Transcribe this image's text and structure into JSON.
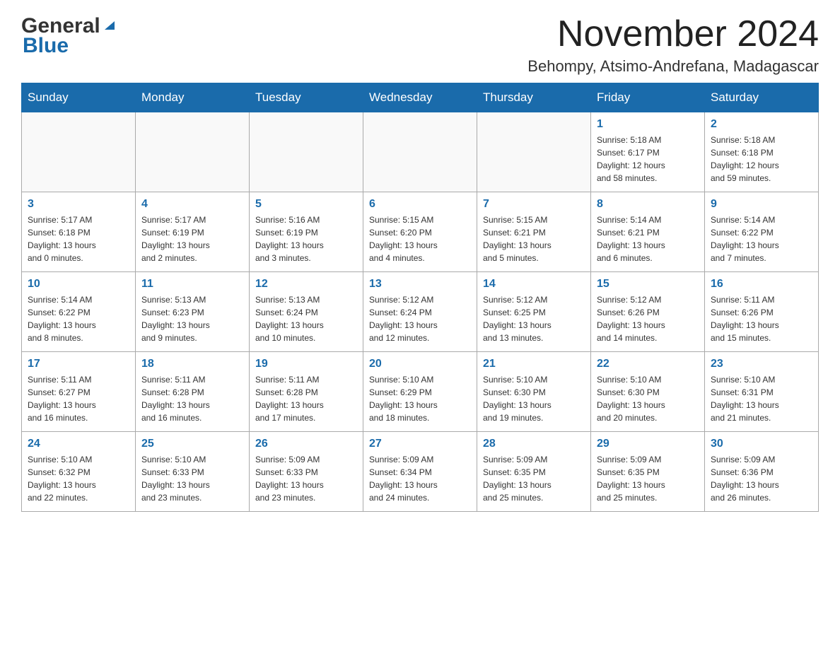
{
  "header": {
    "logo_general": "General",
    "logo_blue": "Blue",
    "month_title": "November 2024",
    "location": "Behompy, Atsimo-Andrefana, Madagascar"
  },
  "days_of_week": [
    "Sunday",
    "Monday",
    "Tuesday",
    "Wednesday",
    "Thursday",
    "Friday",
    "Saturday"
  ],
  "weeks": [
    [
      {
        "day": "",
        "info": ""
      },
      {
        "day": "",
        "info": ""
      },
      {
        "day": "",
        "info": ""
      },
      {
        "day": "",
        "info": ""
      },
      {
        "day": "",
        "info": ""
      },
      {
        "day": "1",
        "info": "Sunrise: 5:18 AM\nSunset: 6:17 PM\nDaylight: 12 hours\nand 58 minutes."
      },
      {
        "day": "2",
        "info": "Sunrise: 5:18 AM\nSunset: 6:18 PM\nDaylight: 12 hours\nand 59 minutes."
      }
    ],
    [
      {
        "day": "3",
        "info": "Sunrise: 5:17 AM\nSunset: 6:18 PM\nDaylight: 13 hours\nand 0 minutes."
      },
      {
        "day": "4",
        "info": "Sunrise: 5:17 AM\nSunset: 6:19 PM\nDaylight: 13 hours\nand 2 minutes."
      },
      {
        "day": "5",
        "info": "Sunrise: 5:16 AM\nSunset: 6:19 PM\nDaylight: 13 hours\nand 3 minutes."
      },
      {
        "day": "6",
        "info": "Sunrise: 5:15 AM\nSunset: 6:20 PM\nDaylight: 13 hours\nand 4 minutes."
      },
      {
        "day": "7",
        "info": "Sunrise: 5:15 AM\nSunset: 6:21 PM\nDaylight: 13 hours\nand 5 minutes."
      },
      {
        "day": "8",
        "info": "Sunrise: 5:14 AM\nSunset: 6:21 PM\nDaylight: 13 hours\nand 6 minutes."
      },
      {
        "day": "9",
        "info": "Sunrise: 5:14 AM\nSunset: 6:22 PM\nDaylight: 13 hours\nand 7 minutes."
      }
    ],
    [
      {
        "day": "10",
        "info": "Sunrise: 5:14 AM\nSunset: 6:22 PM\nDaylight: 13 hours\nand 8 minutes."
      },
      {
        "day": "11",
        "info": "Sunrise: 5:13 AM\nSunset: 6:23 PM\nDaylight: 13 hours\nand 9 minutes."
      },
      {
        "day": "12",
        "info": "Sunrise: 5:13 AM\nSunset: 6:24 PM\nDaylight: 13 hours\nand 10 minutes."
      },
      {
        "day": "13",
        "info": "Sunrise: 5:12 AM\nSunset: 6:24 PM\nDaylight: 13 hours\nand 12 minutes."
      },
      {
        "day": "14",
        "info": "Sunrise: 5:12 AM\nSunset: 6:25 PM\nDaylight: 13 hours\nand 13 minutes."
      },
      {
        "day": "15",
        "info": "Sunrise: 5:12 AM\nSunset: 6:26 PM\nDaylight: 13 hours\nand 14 minutes."
      },
      {
        "day": "16",
        "info": "Sunrise: 5:11 AM\nSunset: 6:26 PM\nDaylight: 13 hours\nand 15 minutes."
      }
    ],
    [
      {
        "day": "17",
        "info": "Sunrise: 5:11 AM\nSunset: 6:27 PM\nDaylight: 13 hours\nand 16 minutes."
      },
      {
        "day": "18",
        "info": "Sunrise: 5:11 AM\nSunset: 6:28 PM\nDaylight: 13 hours\nand 16 minutes."
      },
      {
        "day": "19",
        "info": "Sunrise: 5:11 AM\nSunset: 6:28 PM\nDaylight: 13 hours\nand 17 minutes."
      },
      {
        "day": "20",
        "info": "Sunrise: 5:10 AM\nSunset: 6:29 PM\nDaylight: 13 hours\nand 18 minutes."
      },
      {
        "day": "21",
        "info": "Sunrise: 5:10 AM\nSunset: 6:30 PM\nDaylight: 13 hours\nand 19 minutes."
      },
      {
        "day": "22",
        "info": "Sunrise: 5:10 AM\nSunset: 6:30 PM\nDaylight: 13 hours\nand 20 minutes."
      },
      {
        "day": "23",
        "info": "Sunrise: 5:10 AM\nSunset: 6:31 PM\nDaylight: 13 hours\nand 21 minutes."
      }
    ],
    [
      {
        "day": "24",
        "info": "Sunrise: 5:10 AM\nSunset: 6:32 PM\nDaylight: 13 hours\nand 22 minutes."
      },
      {
        "day": "25",
        "info": "Sunrise: 5:10 AM\nSunset: 6:33 PM\nDaylight: 13 hours\nand 23 minutes."
      },
      {
        "day": "26",
        "info": "Sunrise: 5:09 AM\nSunset: 6:33 PM\nDaylight: 13 hours\nand 23 minutes."
      },
      {
        "day": "27",
        "info": "Sunrise: 5:09 AM\nSunset: 6:34 PM\nDaylight: 13 hours\nand 24 minutes."
      },
      {
        "day": "28",
        "info": "Sunrise: 5:09 AM\nSunset: 6:35 PM\nDaylight: 13 hours\nand 25 minutes."
      },
      {
        "day": "29",
        "info": "Sunrise: 5:09 AM\nSunset: 6:35 PM\nDaylight: 13 hours\nand 25 minutes."
      },
      {
        "day": "30",
        "info": "Sunrise: 5:09 AM\nSunset: 6:36 PM\nDaylight: 13 hours\nand 26 minutes."
      }
    ]
  ]
}
